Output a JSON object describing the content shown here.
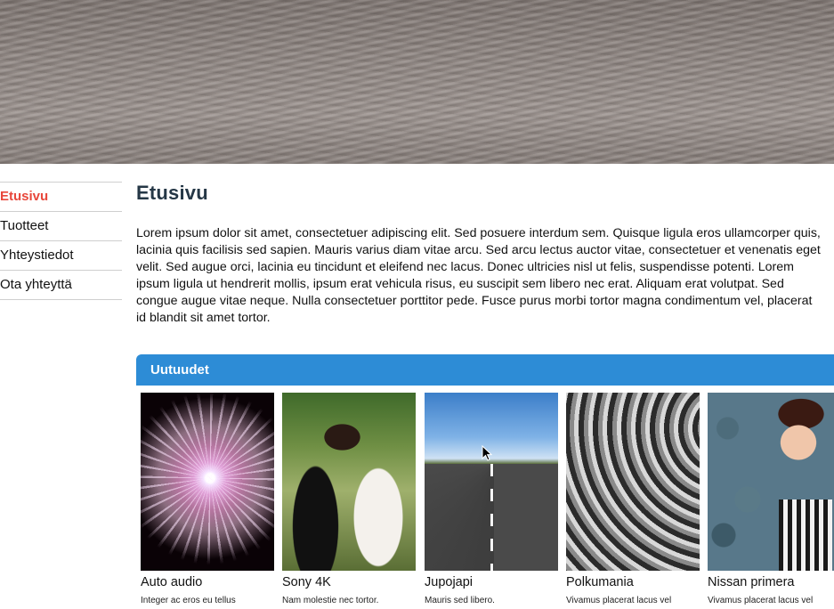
{
  "nav": {
    "items": [
      {
        "label": "Etusivu",
        "active": true
      },
      {
        "label": "Tuotteet",
        "active": false
      },
      {
        "label": "Yhteystiedot",
        "active": false
      },
      {
        "label": "Ota yhteyttä",
        "active": false
      }
    ]
  },
  "main": {
    "title": "Etusivu",
    "intro": "Lorem ipsum dolor sit amet, consectetuer adipiscing elit. Sed posuere interdum sem. Quisque ligula eros ullamcorper quis, lacinia quis facilisis sed sapien. Mauris varius diam vitae arcu. Sed arcu lectus auctor vitae, consectetuer et venenatis eget velit. Sed augue orci, lacinia eu tincidunt et eleifend nec lacus. Donec ultricies nisl ut felis, suspendisse potenti. Lorem ipsum ligula ut hendrerit mollis, ipsum erat vehicula risus, eu suscipit sem libero nec erat. Aliquam erat volutpat. Sed congue augue vitae neque. Nulla consectetuer porttitor pede. Fusce purus morbi tortor magna condimentum vel, placerat id blandit sit amet tortor."
  },
  "news": {
    "header": "Uutuudet",
    "items": [
      {
        "title": "Auto audio",
        "desc": "Integer ac eros eu tellus",
        "image": "fireworks"
      },
      {
        "title": "Sony 4K",
        "desc": "Nam molestie nec tortor.",
        "image": "wedding-couple"
      },
      {
        "title": "Jupojapi",
        "desc": "Mauris sed libero.",
        "image": "road"
      },
      {
        "title": "Polkumania",
        "desc": "Vivamus placerat lacus vel",
        "image": "curved-stairs"
      },
      {
        "title": "Nissan primera",
        "desc": "Vivamus placerat lacus vel",
        "image": "woman-sunglasses"
      }
    ]
  },
  "colors": {
    "accent": "#2d8cd6",
    "active_nav": "#e8473b",
    "title": "#253746"
  }
}
